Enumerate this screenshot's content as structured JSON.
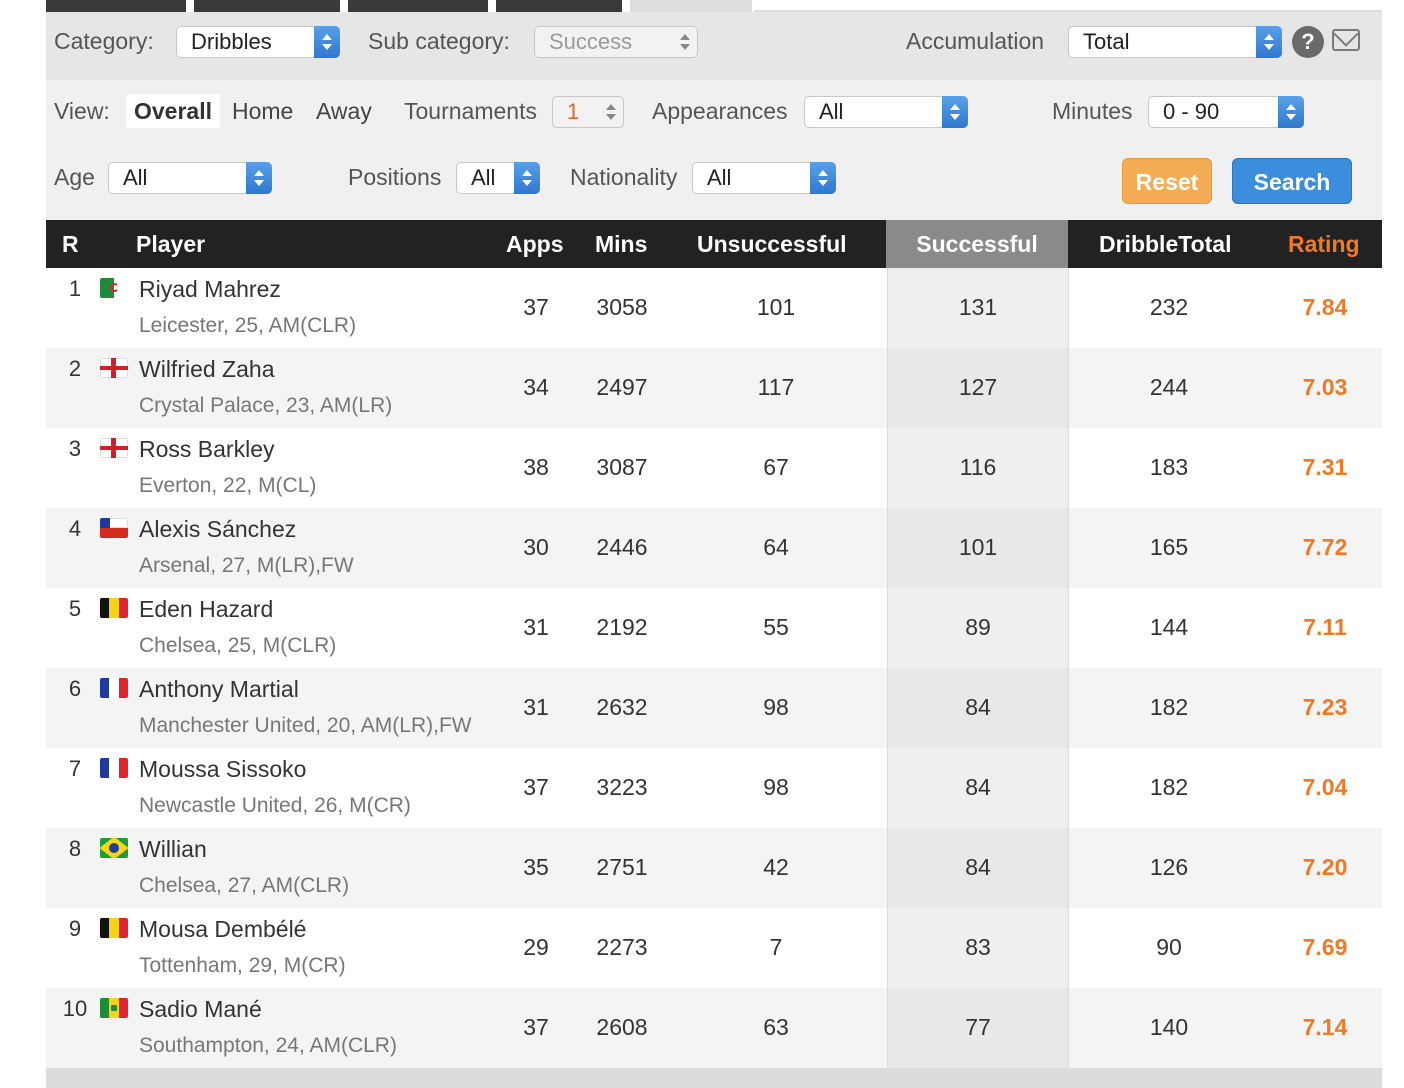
{
  "filters": {
    "category_label": "Category:",
    "category_value": "Dribbles",
    "subcategory_label": "Sub category:",
    "subcategory_value": "Success",
    "accumulation_label": "Accumulation",
    "accumulation_value": "Total",
    "help_label": "?",
    "view_label": "View:",
    "view_options": [
      "Overall",
      "Home",
      "Away"
    ],
    "tournaments_label": "Tournaments",
    "tournaments_value": "1",
    "appearances_label": "Appearances",
    "appearances_value": "All",
    "minutes_label": "Minutes",
    "minutes_value": "0 - 90",
    "age_label": "Age",
    "age_value": "All",
    "positions_label": "Positions",
    "positions_value": "All",
    "nationality_label": "Nationality",
    "nationality_value": "All",
    "reset_label": "Reset",
    "search_label": "Search"
  },
  "table": {
    "headers": {
      "rank": "R",
      "player": "Player",
      "apps": "Apps",
      "mins": "Mins",
      "unsuccessful": "Unsuccessful",
      "successful": "Successful",
      "total": "DribbleTotal",
      "rating": "Rating"
    },
    "rows": [
      {
        "rank": "1",
        "name": "Riyad Mahrez",
        "info": "Leicester, 25, AM(CLR)",
        "apps": "37",
        "mins": "3058",
        "unsuccessful": "101",
        "successful": "131",
        "total": "232",
        "rating": "7.84",
        "flag": "algeria"
      },
      {
        "rank": "2",
        "name": "Wilfried Zaha",
        "info": "Crystal Palace, 23, AM(LR)",
        "apps": "34",
        "mins": "2497",
        "unsuccessful": "117",
        "successful": "127",
        "total": "244",
        "rating": "7.03",
        "flag": "england"
      },
      {
        "rank": "3",
        "name": "Ross Barkley",
        "info": "Everton, 22, M(CL)",
        "apps": "38",
        "mins": "3087",
        "unsuccessful": "67",
        "successful": "116",
        "total": "183",
        "rating": "7.31",
        "flag": "england"
      },
      {
        "rank": "4",
        "name": "Alexis Sánchez",
        "info": "Arsenal, 27, M(LR),FW",
        "apps": "30",
        "mins": "2446",
        "unsuccessful": "64",
        "successful": "101",
        "total": "165",
        "rating": "7.72",
        "flag": "chile"
      },
      {
        "rank": "5",
        "name": "Eden Hazard",
        "info": "Chelsea, 25, M(CLR)",
        "apps": "31",
        "mins": "2192",
        "unsuccessful": "55",
        "successful": "89",
        "total": "144",
        "rating": "7.11",
        "flag": "belgium"
      },
      {
        "rank": "6",
        "name": "Anthony Martial",
        "info": "Manchester United, 20, AM(LR),FW",
        "apps": "31",
        "mins": "2632",
        "unsuccessful": "98",
        "successful": "84",
        "total": "182",
        "rating": "7.23",
        "flag": "france"
      },
      {
        "rank": "7",
        "name": "Moussa Sissoko",
        "info": "Newcastle United, 26, M(CR)",
        "apps": "37",
        "mins": "3223",
        "unsuccessful": "98",
        "successful": "84",
        "total": "182",
        "rating": "7.04",
        "flag": "france"
      },
      {
        "rank": "8",
        "name": "Willian",
        "info": "Chelsea, 27, AM(CLR)",
        "apps": "35",
        "mins": "2751",
        "unsuccessful": "42",
        "successful": "84",
        "total": "126",
        "rating": "7.20",
        "flag": "brazil"
      },
      {
        "rank": "9",
        "name": "Mousa Dembélé",
        "info": "Tottenham, 29, M(CR)",
        "apps": "29",
        "mins": "2273",
        "unsuccessful": "7",
        "successful": "83",
        "total": "90",
        "rating": "7.69",
        "flag": "belgium"
      },
      {
        "rank": "10",
        "name": "Sadio Mané",
        "info": "Southampton, 24, AM(CLR)",
        "apps": "37",
        "mins": "2608",
        "unsuccessful": "63",
        "successful": "77",
        "total": "140",
        "rating": "7.14",
        "flag": "senegal"
      }
    ]
  },
  "colors": {
    "accent_rating": "#f07a24",
    "header_bg": "#222222",
    "reset_button": "#f4ad55",
    "search_button": "#3a8edb"
  },
  "icons": [
    "help-icon",
    "mail-icon"
  ]
}
